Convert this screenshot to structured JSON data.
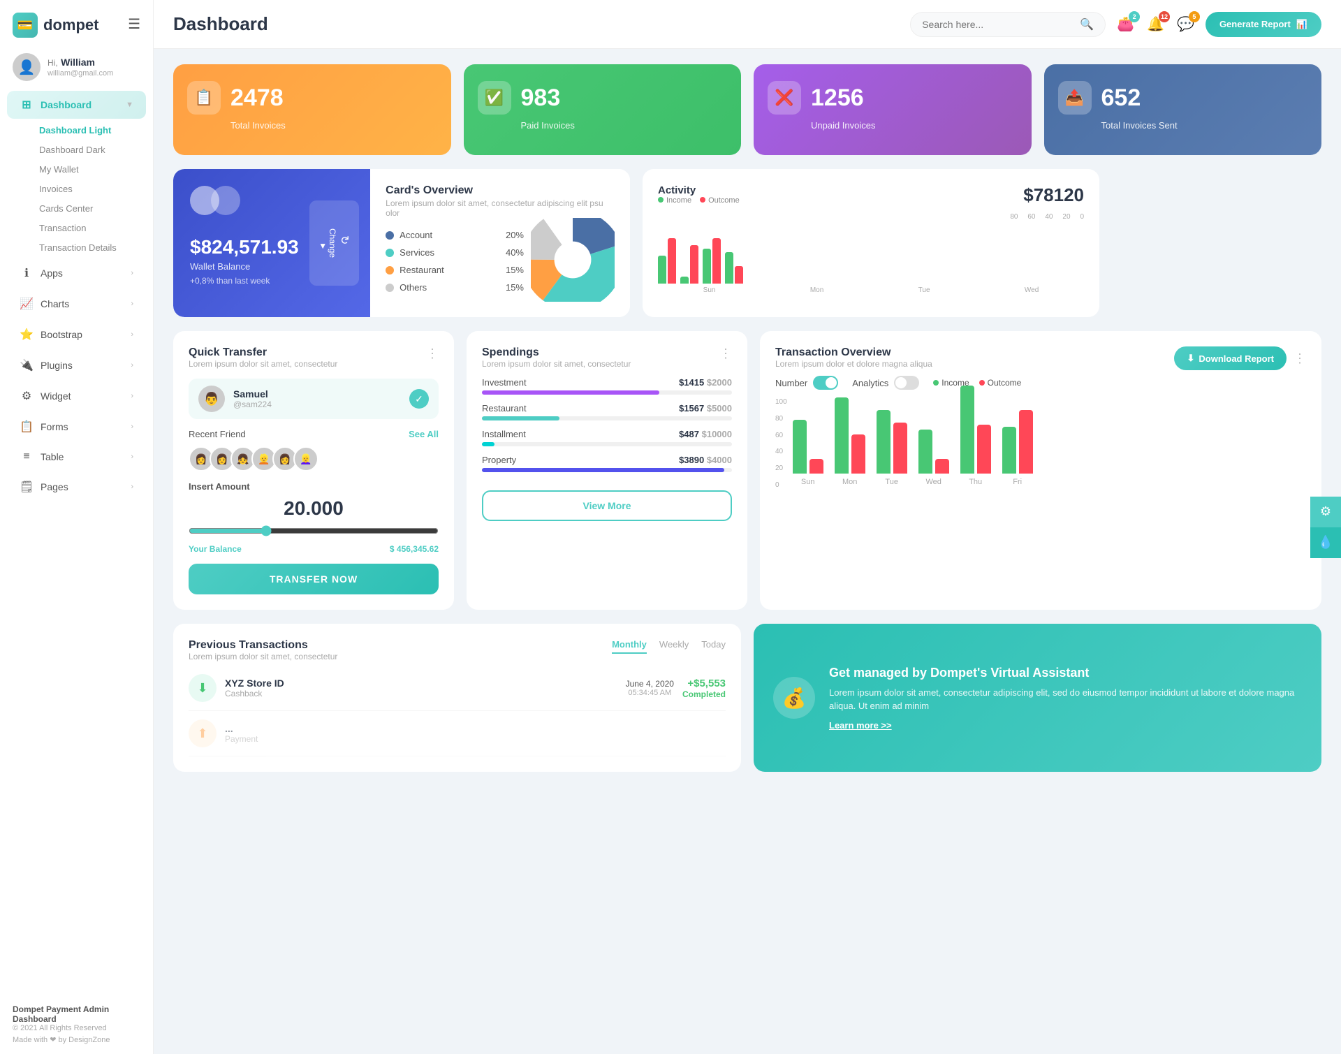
{
  "logo": {
    "text": "dompet",
    "icon": "💳"
  },
  "hamburger": "☰",
  "user": {
    "greeting": "Hi,",
    "name": "William",
    "email": "william@gmail.com",
    "avatar": "👤"
  },
  "nav": {
    "active": "Dashboard",
    "items": [
      {
        "id": "dashboard",
        "label": "Dashboard",
        "icon": "⊞",
        "hasArrow": true,
        "active": true
      },
      {
        "id": "apps",
        "label": "Apps",
        "icon": "ℹ",
        "hasArrow": true
      },
      {
        "id": "charts",
        "label": "Charts",
        "icon": "📈",
        "hasArrow": true
      },
      {
        "id": "bootstrap",
        "label": "Bootstrap",
        "icon": "⭐",
        "hasArrow": true
      },
      {
        "id": "plugins",
        "label": "Plugins",
        "icon": "🔌",
        "hasArrow": true
      },
      {
        "id": "widget",
        "label": "Widget",
        "icon": "⚙",
        "hasArrow": true
      },
      {
        "id": "forms",
        "label": "Forms",
        "icon": "📋",
        "hasArrow": true
      },
      {
        "id": "table",
        "label": "Table",
        "icon": "≡",
        "hasArrow": true
      },
      {
        "id": "pages",
        "label": "Pages",
        "icon": "🗒",
        "hasArrow": true
      }
    ],
    "submenu": [
      "Dashboard Light",
      "Dashboard Dark",
      "My Wallet",
      "Invoices",
      "Cards Center",
      "Transaction",
      "Transaction Details"
    ]
  },
  "header": {
    "title": "Dashboard",
    "search_placeholder": "Search here...",
    "generate_btn": "Generate Report",
    "badges": {
      "wallet": "2",
      "notification": "12",
      "message": "5"
    }
  },
  "stats": [
    {
      "number": "2478",
      "label": "Total Invoices",
      "icon": "📋",
      "color": "orange"
    },
    {
      "number": "983",
      "label": "Paid Invoices",
      "icon": "✓",
      "color": "green"
    },
    {
      "number": "1256",
      "label": "Unpaid Invoices",
      "icon": "✗",
      "color": "purple"
    },
    {
      "number": "652",
      "label": "Total Invoices Sent",
      "icon": "📤",
      "color": "teal"
    }
  ],
  "card_widget": {
    "amount": "$824,571.93",
    "label": "Wallet Balance",
    "change": "+0,8% than last week",
    "btn_label": "Change"
  },
  "overview": {
    "title": "Card's Overview",
    "subtitle": "Lorem ipsum dolor sit amet, consectetur adipiscing elit psu olor",
    "items": [
      {
        "label": "Account",
        "percent": "20%",
        "color": "#4a6fa5"
      },
      {
        "label": "Services",
        "percent": "40%",
        "color": "#4ecdc4"
      },
      {
        "label": "Restaurant",
        "percent": "15%",
        "color": "#ff9f43"
      },
      {
        "label": "Others",
        "percent": "15%",
        "color": "#ccc"
      }
    ]
  },
  "activity": {
    "title": "Activity",
    "amount": "$78120",
    "legend": [
      {
        "label": "Income",
        "color": "#48c774"
      },
      {
        "label": "Outcome",
        "color": "#ff4757"
      }
    ],
    "bars": [
      {
        "day": "Sun",
        "income": 40,
        "outcome": 65
      },
      {
        "day": "Mon",
        "income": 10,
        "outcome": 55
      },
      {
        "day": "Tue",
        "income": 50,
        "outcome": 65
      },
      {
        "day": "Wed",
        "income": 45,
        "outcome": 25
      }
    ]
  },
  "quick_transfer": {
    "title": "Quick Transfer",
    "subtitle": "Lorem ipsum dolor sit amet, consectetur",
    "user": {
      "name": "Samuel",
      "handle": "@sam224",
      "avatar": "👨"
    },
    "recent_label": "Recent Friend",
    "see_all": "See All",
    "insert_amount_label": "Insert Amount",
    "amount": "20.000",
    "balance_label": "Your Balance",
    "balance": "$ 456,345.62",
    "transfer_btn": "TRANSFER NOW",
    "friends": [
      "👩",
      "👩",
      "👧",
      "👱",
      "👩",
      "👱‍♀️"
    ]
  },
  "spendings": {
    "title": "Spendings",
    "subtitle": "Lorem ipsum dolor sit amet, consectetur",
    "items": [
      {
        "label": "Investment",
        "amount": "$1415",
        "total": "$2000",
        "percent": 71,
        "color": "#a855f7"
      },
      {
        "label": "Restaurant",
        "amount": "$1567",
        "total": "$5000",
        "percent": 31,
        "color": "#4ecdc4"
      },
      {
        "label": "Installment",
        "amount": "$487",
        "total": "$10000",
        "percent": 5,
        "color": "#00d2d3"
      },
      {
        "label": "Property",
        "amount": "$3890",
        "total": "$4000",
        "percent": 97,
        "color": "#5352ed"
      }
    ],
    "view_more": "View More"
  },
  "transaction_overview": {
    "title": "Transaction Overview",
    "subtitle": "Lorem ipsum dolor et dolore magna aliqua",
    "download_btn": "Download Report",
    "toggles": [
      {
        "label": "Number",
        "active": true
      },
      {
        "label": "Analytics",
        "active": false
      }
    ],
    "legend": [
      {
        "label": "Income",
        "color": "#48c774"
      },
      {
        "label": "Outcome",
        "color": "#ff4757"
      }
    ],
    "bars": [
      {
        "day": "Sun",
        "income": 55,
        "outcome": 15
      },
      {
        "day": "Mon",
        "income": 78,
        "outcome": 40
      },
      {
        "day": "Tue",
        "income": 65,
        "outcome": 52
      },
      {
        "day": "Wed",
        "income": 45,
        "outcome": 15
      },
      {
        "day": "Thu",
        "income": 90,
        "outcome": 50
      },
      {
        "day": "Fri",
        "income": 48,
        "outcome": 65
      }
    ],
    "y_axis": [
      "0",
      "20",
      "40",
      "60",
      "80",
      "100"
    ]
  },
  "prev_transactions": {
    "title": "Previous Transactions",
    "subtitle": "Lorem ipsum dolor sit amet, consectetur",
    "tabs": [
      "Monthly",
      "Weekly",
      "Today"
    ],
    "active_tab": "Monthly",
    "items": [
      {
        "name": "XYZ Store ID",
        "type": "Cashback",
        "date": "June 4, 2020",
        "time": "05:34:45 AM",
        "amount": "+$5,553",
        "status": "Completed",
        "icon": "⬇",
        "icon_bg": "#e8faf3",
        "icon_color": "#48c774",
        "amount_color": "#48c774",
        "status_color": "#48c774"
      }
    ]
  },
  "virtual_assistant": {
    "title": "Get managed by Dompet's Virtual Assistant",
    "text": "Lorem ipsum dolor sit amet, consectetur adipiscing elit, sed do eiusmod tempor incididunt ut labore et dolore magna aliqua. Ut enim ad minim",
    "learn_more": "Learn more >>",
    "icon": "💰"
  },
  "footer": {
    "brand": "Dompet Payment Admin Dashboard",
    "year": "© 2021 All Rights Reserved",
    "made_by": "Made with ❤ by DesignZone"
  }
}
